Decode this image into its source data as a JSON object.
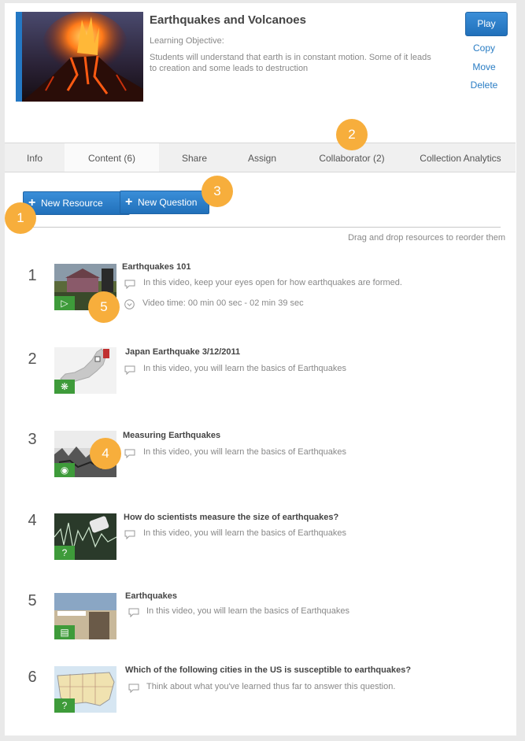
{
  "collection": {
    "title": "Earthquakes and Volcanoes",
    "objective_label": "Learning Objective:",
    "objective_text": "Students will understand that earth is in constant motion. Some of it leads to creation and some leads to destruction"
  },
  "actions": {
    "play": "Play",
    "copy": "Copy",
    "move": "Move",
    "delete": "Delete"
  },
  "tabs": [
    {
      "label": "Info"
    },
    {
      "label": "Content (6)"
    },
    {
      "label": "Share"
    },
    {
      "label": "Assign"
    },
    {
      "label": "Collaborator (2)"
    },
    {
      "label": "Collection Analytics"
    }
  ],
  "toolbar": {
    "new_resource": "New Resource",
    "new_question": "New Question",
    "drag_hint": "Drag and drop resources to reorder them"
  },
  "callouts": [
    "1",
    "2",
    "3",
    "4",
    "5"
  ],
  "resources": [
    {
      "num": "1",
      "title": "Earthquakes 101",
      "desc": "In this video, keep your eyes open for how earthquakes are formed.",
      "time": "Video time: 00 min 00 sec - 02 min 39 sec",
      "type_icon": "video-icon"
    },
    {
      "num": "2",
      "title": "Japan Earthquake 3/12/2011",
      "desc": "In this video, you will learn the basics of Earthquakes",
      "type_icon": "interactive-icon"
    },
    {
      "num": "3",
      "title": "Measuring Earthquakes",
      "desc": "In this video, you will learn the basics of Earthquakes",
      "type_icon": "webpage-icon"
    },
    {
      "num": "4",
      "title": "How do scientists measure the size of earthquakes?",
      "desc": "In this video, you will learn the basics of Earthquakes",
      "type_icon": "question-icon"
    },
    {
      "num": "5",
      "title": "Earthquakes",
      "desc": "In this video, you will learn the basics of Earthquakes",
      "type_icon": "text-icon"
    },
    {
      "num": "6",
      "title": "Which of the following cities in the US is susceptible to earthquakes?",
      "desc": "Think about what you've learned thus far to answer this question.",
      "type_icon": "question-icon"
    }
  ],
  "colors": {
    "accent_blue": "#2478c4",
    "badge_orange": "#f7ae3c",
    "type_green": "#3e9b3a"
  }
}
